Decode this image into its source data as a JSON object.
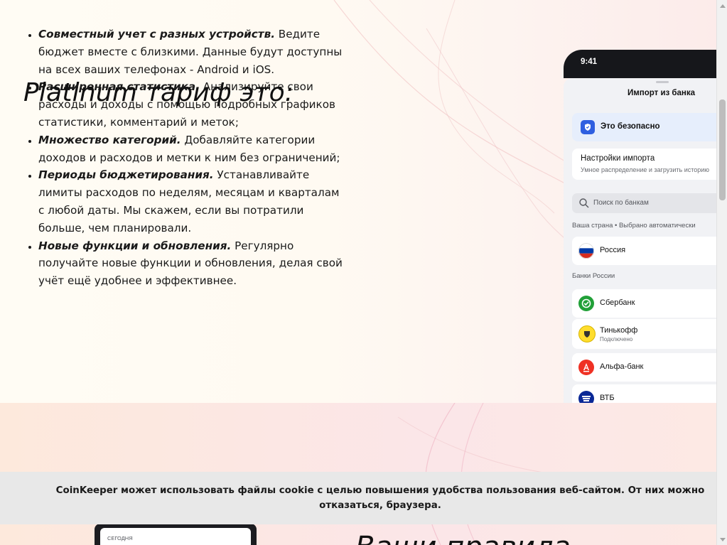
{
  "features": [
    {
      "title": "Совместный учет с разных устройств.",
      "text": " Ведите бюджет вместе с близкими. Данные будут доступны на всех ваших телефонах - Android и iOS."
    },
    {
      "title": "Расширенная статистика.",
      "text": " Анализируйте свои расходы и доходы с помощью подробных графиков статистики, комментарий и меток;"
    },
    {
      "title": "Множество категорий.",
      "text": " Добавляйте категории доходов и расходов и метки к ним без ограничений;"
    },
    {
      "title": "Периоды бюджетирования.",
      "text": " Устанавливайте лимиты расходов по неделям, месяцам и кварталам с любой даты. Мы скажем, если вы потратили больше, чем планировали."
    },
    {
      "title": "Новые функции и обновления.",
      "text": " Регулярно получайте новые функции и обновления, делая свой учёт ещё удобнее и эффективнее."
    }
  ],
  "overlay_title": "Platinum тариф это:",
  "phone": {
    "time": "9:41",
    "sheet_title": "Импорт из банка",
    "safe_label": "Это безопасно",
    "settings_title": "Настройки импорта",
    "settings_sub": "Умное распределение и загрузить историю",
    "search_placeholder": "Поиск по банкам",
    "country_label": "Ваша страна • Выбрано автоматически",
    "country": "Россия",
    "banks_label": "Банки России",
    "banks": [
      {
        "name": "Сбербанк",
        "sub": "",
        "color": "#21a038"
      },
      {
        "name": "Тинькофф",
        "sub": "Подключено",
        "color": "#ffdd2d"
      },
      {
        "name": "Альфа-банк",
        "sub": "",
        "color": "#ef3124"
      },
      {
        "name": "ВТБ",
        "sub": "",
        "color": "#0a2896"
      }
    ]
  },
  "bottom": {
    "today_label": "СЕГОДНЯ",
    "heading": "Ваши правила"
  },
  "cookie": {
    "text": "CoinKeeper может использовать файлы cookie с целью повышения удобства пользования веб-сайтом. От них можно отказаться, браузера."
  },
  "colors": {
    "accent_blue": "#2f5fe0",
    "cookie_bg": "#e8e8e8"
  }
}
